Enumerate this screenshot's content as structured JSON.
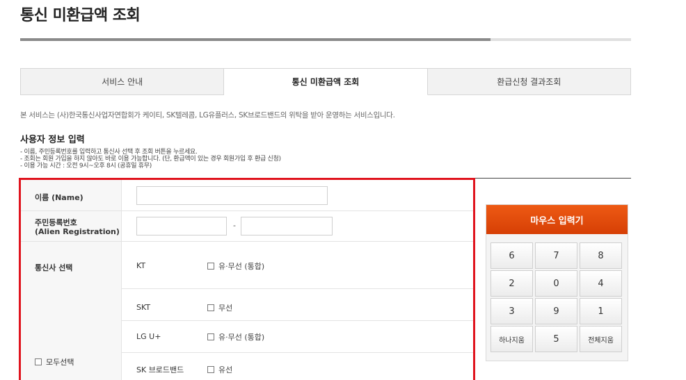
{
  "page": {
    "title": "통신 미환급액 조회",
    "title_progress_fraction": 0.77
  },
  "tabs": [
    {
      "label": "서비스 안내",
      "active": false
    },
    {
      "label": "통신 미환급액 조회",
      "active": true
    },
    {
      "label": "환급신청 결과조회",
      "active": false
    }
  ],
  "notice": "본 서비스는 (사)한국통신사업자연합회가 케이티, SK텔레콤, LG유플러스, SK브로드밴드의 위탁을 받아 운영하는 서비스입니다.",
  "user_info": {
    "title": "사용자 정보 입력",
    "instructions": [
      "- 이름, 주민등록번호를 입력하고 통신사 선택 후 조회 버튼을 누르세요.",
      "- 조회는 회원 가입을 하지 않아도 바로 이용 가능합니다. (단, 환급액이 있는 경우 회원가입 후 환급 신청)",
      "- 이용 가능 시간 : 오전 9시~오후 8시 (공휴일 휴무)"
    ]
  },
  "form": {
    "name_label": "이름 (Name)",
    "name_value": "",
    "id_label": "주민등록번호",
    "id_label_sub": "(Alien Registration)",
    "id_first_value": "",
    "id_separator": "-",
    "id_second_value": "",
    "carrier_label": "통신사 선택",
    "select_all_label": "모두선택",
    "carriers": [
      {
        "name": "KT",
        "option": "유·무선 (통합)"
      },
      {
        "name": "SKT",
        "option": "무선"
      },
      {
        "name": "LG U+",
        "option": "유·무선 (통합)"
      },
      {
        "name": "SK 브로드밴드",
        "option": "유선"
      }
    ]
  },
  "keypad": {
    "title": "마우스 입력기",
    "keys": [
      "6",
      "7",
      "8",
      "2",
      "0",
      "4",
      "3",
      "9",
      "1",
      "하나지움",
      "5",
      "전체지움"
    ]
  },
  "colors": {
    "highlight_border": "#e0141e",
    "keypad_header": "#e4480a"
  }
}
